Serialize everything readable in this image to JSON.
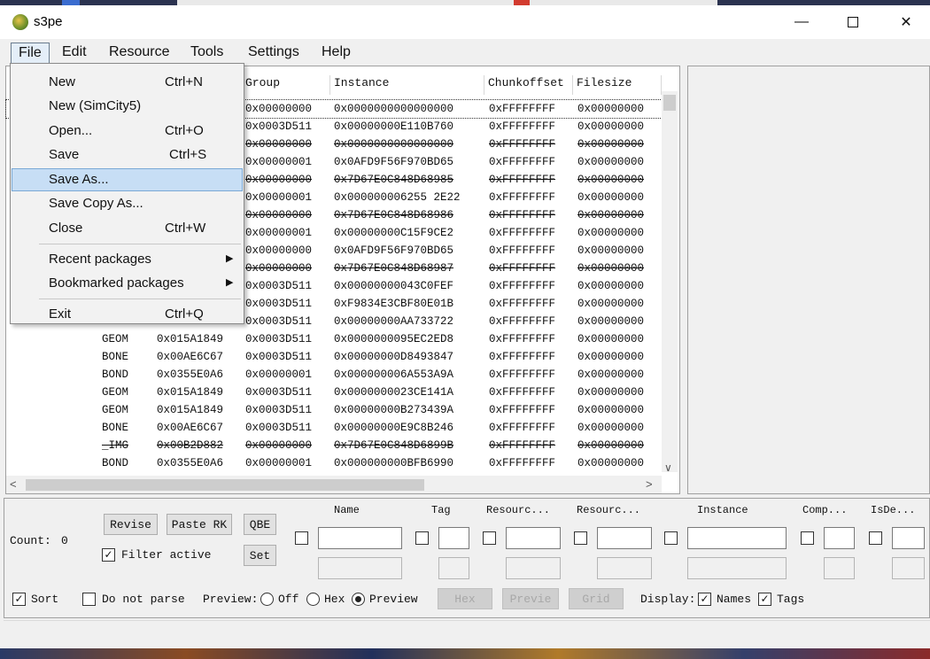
{
  "window": {
    "title": "s3pe"
  },
  "menubar": [
    {
      "label": "File"
    },
    {
      "label": "Edit"
    },
    {
      "label": "Resource"
    },
    {
      "label": "Tools"
    },
    {
      "label": "Settings"
    },
    {
      "label": "Help"
    }
  ],
  "file_menu": [
    {
      "label": "New",
      "shortcut": "Ctrl+N"
    },
    {
      "label": "New (SimCity5)",
      "shortcut": ""
    },
    {
      "label": "Open...",
      "shortcut": "Ctrl+O"
    },
    {
      "label": "Save",
      "shortcut": "Ctrl+S"
    },
    {
      "label": "Save As...",
      "shortcut": ""
    },
    {
      "label": "Save Copy As...",
      "shortcut": ""
    },
    {
      "label": "Close",
      "shortcut": "Ctrl+W"
    },
    {
      "label": "Recent packages",
      "shortcut": ""
    },
    {
      "label": "Bookmarked packages",
      "shortcut": ""
    },
    {
      "label": "Exit",
      "shortcut": "Ctrl+Q"
    }
  ],
  "grid": {
    "columns": [
      "Group",
      "Instance",
      "Chunkoffset",
      "Filesize"
    ],
    "rows": [
      {
        "tag": "",
        "type": "",
        "group": "0x00000000",
        "instance": "0x0000000000000000",
        "chunk": "0xFFFFFFFF",
        "size": "0x00000000",
        "deleted": false
      },
      {
        "tag": "",
        "type": "",
        "group": "0x0003D511",
        "instance": "0x00000000E110B760",
        "chunk": "0xFFFFFFFF",
        "size": "0x00000000",
        "deleted": false
      },
      {
        "tag": "",
        "type": "",
        "group": "0x00000000",
        "instance": "0x0000000000000000",
        "chunk": "0xFFFFFFFF",
        "size": "0x00000000",
        "deleted": true
      },
      {
        "tag": "",
        "type": "",
        "group": "0x00000001",
        "instance": "0x0AFD9F56F970BD65",
        "chunk": "0xFFFFFFFF",
        "size": "0x00000000",
        "deleted": false
      },
      {
        "tag": "",
        "type": "",
        "group": "0x00000000",
        "instance": "0x7D67E0C848D68985",
        "chunk": "0xFFFFFFFF",
        "size": "0x00000000",
        "deleted": true
      },
      {
        "tag": "",
        "type": "",
        "group": "0x00000001",
        "instance": "0x000000006255 2E22",
        "chunk": "0xFFFFFFFF",
        "size": "0x00000000",
        "deleted": false
      },
      {
        "tag": "",
        "type": "",
        "group": "0x00000000",
        "instance": "0x7D67E0C848D68986",
        "chunk": "0xFFFFFFFF",
        "size": "0x00000000",
        "deleted": true
      },
      {
        "tag": "",
        "type": "",
        "group": "0x00000001",
        "instance": "0x00000000C15F9CE2",
        "chunk": "0xFFFFFFFF",
        "size": "0x00000000",
        "deleted": false
      },
      {
        "tag": "",
        "type": "",
        "group": "0x00000000",
        "instance": "0x0AFD9F56F970BD65",
        "chunk": "0xFFFFFFFF",
        "size": "0x00000000",
        "deleted": false
      },
      {
        "tag": "",
        "type": "",
        "group": "0x00000000",
        "instance": "0x7D67E0C848D68987",
        "chunk": "0xFFFFFFFF",
        "size": "0x00000000",
        "deleted": true
      },
      {
        "tag": "",
        "type": "",
        "group": "0x0003D511",
        "instance": "0x00000000043C0FEF",
        "chunk": "0xFFFFFFFF",
        "size": "0x00000000",
        "deleted": false
      },
      {
        "tag": "",
        "type": "",
        "group": "0x0003D511",
        "instance": "0xF9834E3CBF80E01B",
        "chunk": "0xFFFFFFFF",
        "size": "0x00000000",
        "deleted": false
      },
      {
        "tag": "",
        "type": "",
        "group": "0x0003D511",
        "instance": "0x00000000AA733722",
        "chunk": "0xFFFFFFFF",
        "size": "0x00000000",
        "deleted": false
      },
      {
        "tag": "GEOM",
        "type": "0x015A1849",
        "group": "0x0003D511",
        "instance": "0x0000000095EC2ED8",
        "chunk": "0xFFFFFFFF",
        "size": "0x00000000",
        "deleted": false
      },
      {
        "tag": "BONE",
        "type": "0x00AE6C67",
        "group": "0x0003D511",
        "instance": "0x00000000D8493847",
        "chunk": "0xFFFFFFFF",
        "size": "0x00000000",
        "deleted": false
      },
      {
        "tag": "BOND",
        "type": "0x0355E0A6",
        "group": "0x00000001",
        "instance": "0x000000006A553A9A",
        "chunk": "0xFFFFFFFF",
        "size": "0x00000000",
        "deleted": false
      },
      {
        "tag": "GEOM",
        "type": "0x015A1849",
        "group": "0x0003D511",
        "instance": "0x0000000023CE141A",
        "chunk": "0xFFFFFFFF",
        "size": "0x00000000",
        "deleted": false
      },
      {
        "tag": "GEOM",
        "type": "0x015A1849",
        "group": "0x0003D511",
        "instance": "0x00000000B273439A",
        "chunk": "0xFFFFFFFF",
        "size": "0x00000000",
        "deleted": false
      },
      {
        "tag": "BONE",
        "type": "0x00AE6C67",
        "group": "0x0003D511",
        "instance": "0x00000000E9C8B246",
        "chunk": "0xFFFFFFFF",
        "size": "0x00000000",
        "deleted": false
      },
      {
        "tag": "_IMG",
        "type": "0x00B2D882",
        "group": "0x00000000",
        "instance": "0x7D67E0C848D6899B",
        "chunk": "0xFFFFFFFF",
        "size": "0x00000000",
        "deleted": true
      },
      {
        "tag": "BOND",
        "type": "0x0355E0A6",
        "group": "0x00000001",
        "instance": "0x000000000BFB6990",
        "chunk": "0xFFFFFFFF",
        "size": "0x00000000",
        "deleted": false
      }
    ]
  },
  "bottom": {
    "count_label": "Count:",
    "count_value": "0",
    "revise": "Revise",
    "paste_rk": "Paste RK",
    "qbe": "QBE",
    "set": "Set",
    "filter_active": "Filter active",
    "filter_headers": [
      "Name",
      "Tag",
      "Resourc...",
      "Resourc...",
      "Instance",
      "Comp...",
      "IsDe..."
    ],
    "sort": "Sort",
    "do_not_parse": "Do not parse",
    "preview_label": "Preview:",
    "preview_off": "Off",
    "preview_hex": "Hex",
    "preview_preview": "Preview",
    "btn_hex": "Hex",
    "btn_preview": "Previe",
    "btn_grid": "Grid",
    "display_label": "Display:",
    "names": "Names",
    "tags": "Tags"
  }
}
